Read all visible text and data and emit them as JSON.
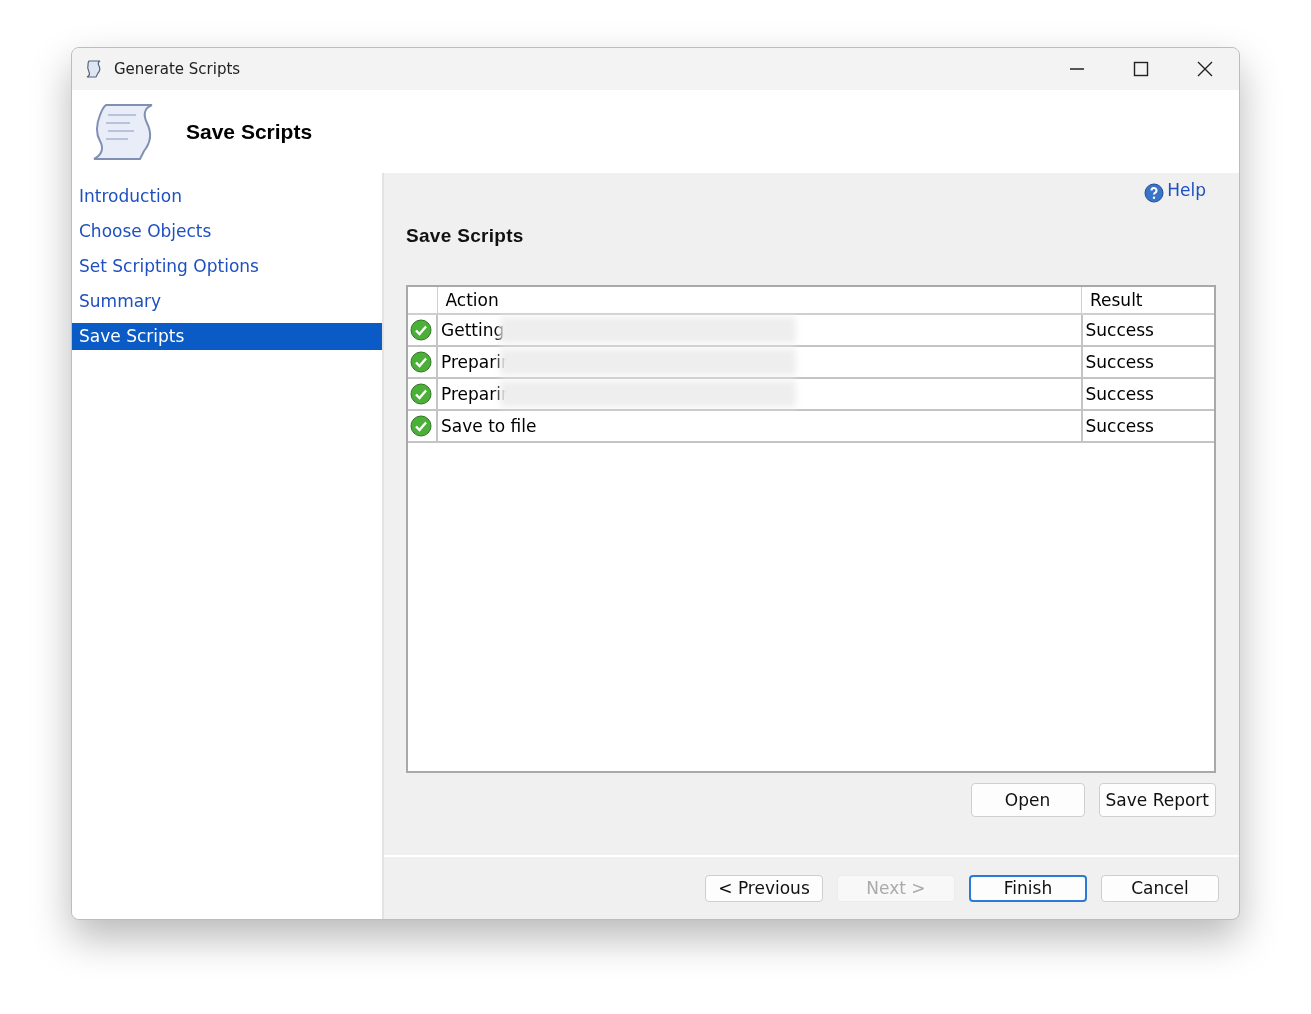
{
  "window": {
    "title": "Generate Scripts"
  },
  "header": {
    "title": "Save Scripts"
  },
  "sidebar": {
    "items": [
      {
        "label": "Introduction",
        "selected": false
      },
      {
        "label": "Choose Objects",
        "selected": false
      },
      {
        "label": "Set Scripting Options",
        "selected": false
      },
      {
        "label": "Summary",
        "selected": false
      },
      {
        "label": "Save Scripts",
        "selected": true
      }
    ]
  },
  "help": {
    "label": "Help"
  },
  "page_title": "Save Scripts",
  "table": {
    "columns": [
      "Action",
      "Result"
    ],
    "rows": [
      {
        "action": "Getting",
        "result": "Success",
        "redacted": true
      },
      {
        "action": "Preparir",
        "result": "Success",
        "redacted": true
      },
      {
        "action": "Preparir",
        "result": "Success",
        "redacted": true
      },
      {
        "action": "Save to file",
        "result": "Success",
        "redacted": false
      }
    ]
  },
  "report_buttons": [
    {
      "label": "Open",
      "disabled": false
    },
    {
      "label": "Save Report",
      "disabled": false
    }
  ],
  "nav_buttons": [
    {
      "label": "< Previous",
      "disabled": false,
      "default": false
    },
    {
      "label": "Next >",
      "disabled": true,
      "default": false
    },
    {
      "label": "Finish",
      "disabled": false,
      "default": true
    },
    {
      "label": "Cancel",
      "disabled": false,
      "default": false
    }
  ]
}
